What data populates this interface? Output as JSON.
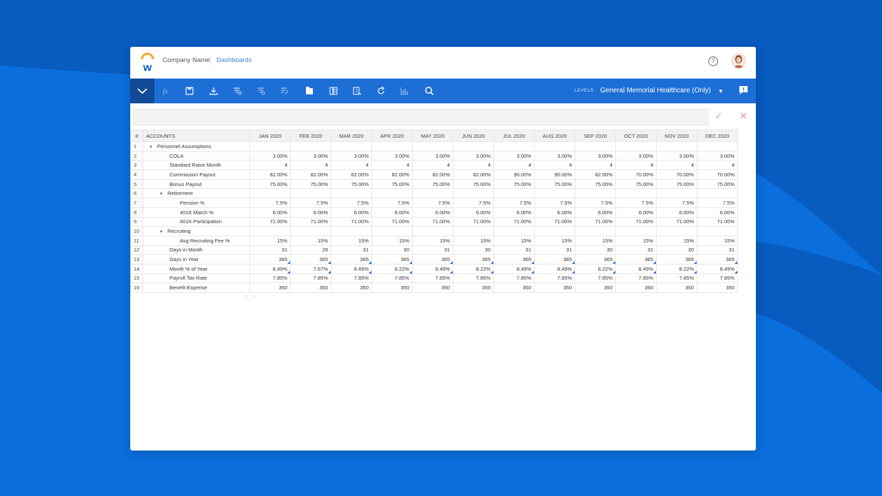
{
  "header": {
    "company": "Company Name",
    "breadcrumb": "Dashboards"
  },
  "toolbar": {
    "levels_label": "LEVELS",
    "levels_value": "General Memorial Healthcare (Only)",
    "icons": [
      "fx-icon",
      "save-icon",
      "download-icon",
      "filter-icon",
      "filter-alt-icon",
      "edit-icon",
      "sheet-icon",
      "columns-icon",
      "export-icon",
      "refresh-icon",
      "chart-icon",
      "search-icon"
    ]
  },
  "grid": {
    "headers": [
      "#",
      "ACCOUNTS",
      "JAN 2020",
      "FEB 2020",
      "MAR 2020",
      "APR 2020",
      "MAY 2020",
      "JUN 2020",
      "JUL 2020",
      "AUG 2020",
      "SEP 2020",
      "OCT 2020",
      "NOV 2020",
      "DEC 2020"
    ],
    "rows": [
      {
        "n": "1",
        "label": "Personnel Assumptions",
        "indent": 0,
        "group": true,
        "values": []
      },
      {
        "n": "2",
        "label": "COLA",
        "indent": 2,
        "values": [
          "3.00%",
          "3.00%",
          "3.00%",
          "3.00%",
          "3.00%",
          "3.00%",
          "3.00%",
          "3.00%",
          "3.00%",
          "3.00%",
          "3.00%",
          "3.00%"
        ]
      },
      {
        "n": "3",
        "label": "Standard Raise Month",
        "indent": 2,
        "values": [
          "4",
          "4",
          "4",
          "4",
          "4",
          "4",
          "4",
          "4",
          "4",
          "4",
          "4",
          "4"
        ]
      },
      {
        "n": "4",
        "label": "Commission Payout",
        "indent": 2,
        "values": [
          "82.00%",
          "82.00%",
          "82.00%",
          "82.00%",
          "82.00%",
          "82.00%",
          "90.00%",
          "90.00%",
          "82.00%",
          "70.00%",
          "70.00%",
          "70.00%"
        ]
      },
      {
        "n": "5",
        "label": "Bonus Payout",
        "indent": 2,
        "values": [
          "75.00%",
          "75.00%",
          "75.00%",
          "75.00%",
          "75.00%",
          "75.00%",
          "75.00%",
          "75.00%",
          "75.00%",
          "75.00%",
          "75.00%",
          "75.00%"
        ]
      },
      {
        "n": "6",
        "label": "Retirement",
        "indent": 1,
        "group": true,
        "values": []
      },
      {
        "n": "7",
        "label": "Pension %",
        "indent": 3,
        "values": [
          "7.5%",
          "7.5%",
          "7.5%",
          "7.5%",
          "7.5%",
          "7.5%",
          "7.5%",
          "7.5%",
          "7.5%",
          "7.5%",
          "7.5%",
          "7.5%"
        ]
      },
      {
        "n": "8",
        "label": "401K Match %",
        "indent": 3,
        "values": [
          "6.00%",
          "6.00%",
          "6.00%",
          "6.00%",
          "6.00%",
          "6.00%",
          "6.00%",
          "6.00%",
          "6.00%",
          "6.00%",
          "6.00%",
          "6.00%"
        ]
      },
      {
        "n": "9",
        "label": "401K Participation",
        "indent": 3,
        "values": [
          "71.00%",
          "71.00%",
          "71.00%",
          "71.00%",
          "71.00%",
          "71.00%",
          "71.00%",
          "71.00%",
          "71.00%",
          "71.00%",
          "71.00%",
          "71.00%"
        ]
      },
      {
        "n": "10",
        "label": "Recruiting",
        "indent": 1,
        "group": true,
        "values": []
      },
      {
        "n": "11",
        "label": "Avg Recruiting Fee %",
        "indent": 3,
        "values": [
          "15%",
          "15%",
          "15%",
          "15%",
          "15%",
          "15%",
          "15%",
          "15%",
          "15%",
          "15%",
          "15%",
          "15%"
        ]
      },
      {
        "n": "12",
        "label": "Days in Month",
        "indent": 2,
        "values": [
          "31",
          "28",
          "31",
          "30",
          "31",
          "30",
          "31",
          "31",
          "30",
          "31",
          "30",
          "31"
        ]
      },
      {
        "n": "13",
        "label": "Days in Year",
        "indent": 2,
        "mark": true,
        "values": [
          "365",
          "365",
          "365",
          "365",
          "365",
          "365",
          "365",
          "365",
          "365",
          "365",
          "365",
          "365"
        ]
      },
      {
        "n": "14",
        "label": "Month % of Year",
        "indent": 2,
        "mark": true,
        "values": [
          "8.49%",
          "7.67%",
          "8.49%",
          "8.22%",
          "8.49%",
          "8.22%",
          "8.49%",
          "8.49%",
          "8.22%",
          "8.49%",
          "8.22%",
          "8.49%"
        ]
      },
      {
        "n": "15",
        "label": "Payroll Tax Rate",
        "indent": 2,
        "values": [
          "7.85%",
          "7.85%",
          "7.85%",
          "7.85%",
          "7.85%",
          "7.85%",
          "7.85%",
          "7.85%",
          "7.85%",
          "7.85%",
          "7.85%",
          "7.85%"
        ]
      },
      {
        "n": "16",
        "label": "Benefit Expense",
        "indent": 2,
        "values": [
          "350",
          "350",
          "350",
          "350",
          "350",
          "350",
          "350",
          "350",
          "350",
          "350",
          "350",
          "350"
        ]
      }
    ]
  },
  "colors": {
    "background": "#0a6fdc",
    "toolbar": "#1d6fd6",
    "toolbar_toggle": "#124a96",
    "accent": "#3a7fd0"
  }
}
